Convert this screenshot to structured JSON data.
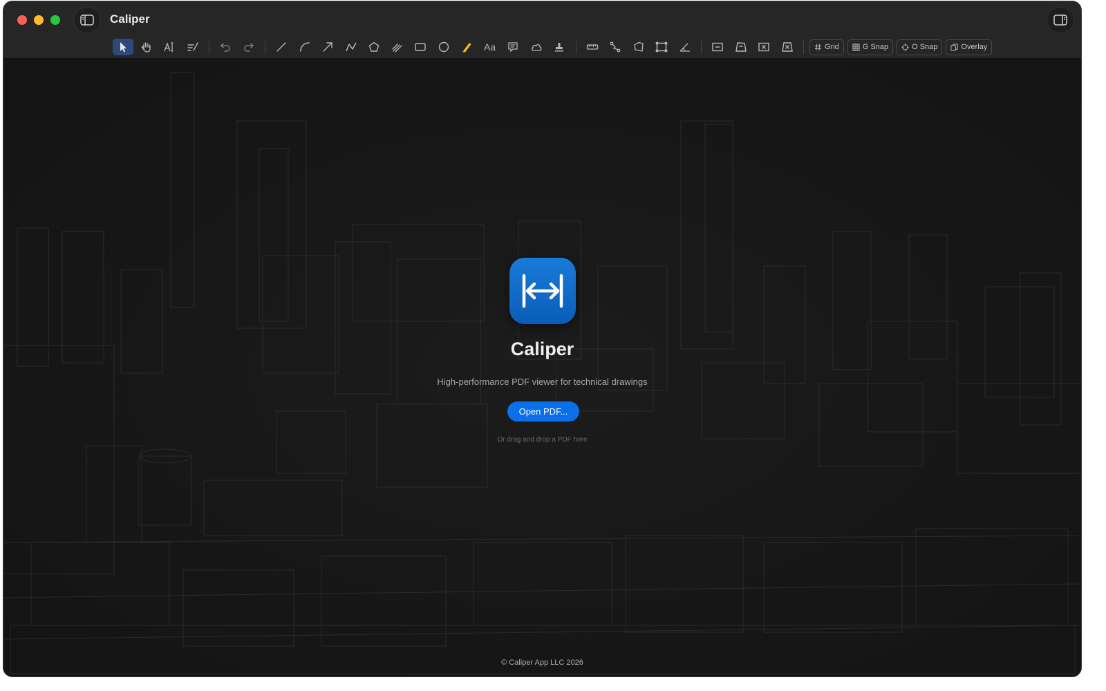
{
  "window": {
    "title": "Caliper"
  },
  "toolbar": {
    "tools": [
      {
        "name": "select-tool",
        "icon": "pointer-arrow-icon",
        "active": true
      },
      {
        "name": "pan-tool",
        "icon": "hand-icon"
      },
      {
        "name": "text-select-tool",
        "icon": "text-cursor-icon"
      },
      {
        "name": "markup-tool",
        "icon": "lines-pen-icon"
      },
      {
        "name": "undo-button",
        "icon": "undo-icon"
      },
      {
        "name": "redo-button",
        "icon": "redo-icon"
      },
      {
        "name": "line-tool",
        "icon": "line-icon"
      },
      {
        "name": "arc-tool",
        "icon": "arc-icon"
      },
      {
        "name": "arrow-tool",
        "icon": "arrow-icon"
      },
      {
        "name": "polyline-tool",
        "icon": "polyline-icon"
      },
      {
        "name": "polygon-tool",
        "icon": "pentagon-icon"
      },
      {
        "name": "freehand-tool",
        "icon": "scribble-icon"
      },
      {
        "name": "rectangle-tool",
        "icon": "rectangle-icon"
      },
      {
        "name": "ellipse-tool",
        "icon": "circle-icon"
      },
      {
        "name": "highlighter-tool",
        "icon": "highlighter-icon"
      },
      {
        "name": "text-tool",
        "icon": "text-aa-icon",
        "label": "Aa"
      },
      {
        "name": "callout-tool",
        "icon": "speech-bubble-icon"
      },
      {
        "name": "cloud-tool",
        "icon": "cloud-icon"
      },
      {
        "name": "stamp-tool",
        "icon": "stamp-icon"
      },
      {
        "name": "measure-length-tool",
        "icon": "ruler-icon"
      },
      {
        "name": "measure-path-tool",
        "icon": "path-icon"
      },
      {
        "name": "measure-area-tool",
        "icon": "polygon-area-icon"
      },
      {
        "name": "measure-rect-area-tool",
        "icon": "rect-area-icon"
      },
      {
        "name": "measure-angle-tool",
        "icon": "angle-icon"
      },
      {
        "name": "cutout-rect-tool",
        "icon": "rect-minus-icon"
      },
      {
        "name": "cutout-poly-tool",
        "icon": "poly-minus-icon"
      },
      {
        "name": "deduct-rect-tool",
        "icon": "rect-x-icon"
      },
      {
        "name": "deduct-poly-tool",
        "icon": "poly-x-icon"
      }
    ],
    "toggles": {
      "grid": "Grid",
      "gsnap": "G Snap",
      "osnap": "O Snap",
      "overlay": "Overlay"
    }
  },
  "welcome": {
    "title": "Caliper",
    "subtitle": "High-performance PDF viewer for technical drawings",
    "open_button": "Open PDF...",
    "drop_hint": "Or drag and drop a PDF here",
    "copyright": "© Caliper App LLC 2026"
  },
  "colors": {
    "accent": "#0a6fe8",
    "background": "#1a1a1a",
    "titlebar": "#262626",
    "active_tool": "#2d4a7a",
    "highlighter": "#f5c518"
  }
}
